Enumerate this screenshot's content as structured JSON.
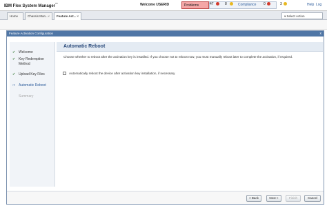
{
  "banner": {
    "app_title": "IBM Flex System Manager",
    "trademark": "™",
    "welcome": "Welcome USERID",
    "problems_label": "Problems",
    "problems_count": "47",
    "warning_count": "8",
    "compliance_label": "Compliance",
    "compliance_error_count": "0",
    "compliance_warning_count": "3",
    "help": "Help",
    "logout": "Log"
  },
  "colors": {
    "problems_bg": "#f4a6a6",
    "error_red": "#d33a2c",
    "warning_yellow": "#e8b820",
    "header_blue": "#4f76a6",
    "link_blue": "#2a5a9a"
  },
  "tabs": [
    {
      "label": "Home"
    },
    {
      "label": "Chassis Man..."
    },
    {
      "label": "Feature Act..."
    }
  ],
  "select_action": "Select Action",
  "dialog": {
    "title": "Feature Activation Configuration",
    "close": "x"
  },
  "wizard": {
    "steps": [
      {
        "label": "Welcome",
        "state": "done"
      },
      {
        "label": "Key Redemption Method",
        "state": "done"
      },
      {
        "label": "Upload Key Files",
        "state": "done"
      },
      {
        "label": "Automatic Reboot",
        "state": "current"
      },
      {
        "label": "Summary",
        "state": "disabled"
      }
    ],
    "icons": {
      "done": "check-icon",
      "current": "arrow-right-icon"
    }
  },
  "content": {
    "title": "Automatic Reboot",
    "description": "Choose whether to reboot after the activation key is installed. If you choose not to reboot now, you must manually reboot later to complete the activation, if required.",
    "option_label": "Automatically reboot the device after activation key installation, if necessary.",
    "option_checked": false
  },
  "buttons": {
    "back": "< Back",
    "next": "Next >",
    "finish": "Finish",
    "cancel": "Cancel"
  }
}
